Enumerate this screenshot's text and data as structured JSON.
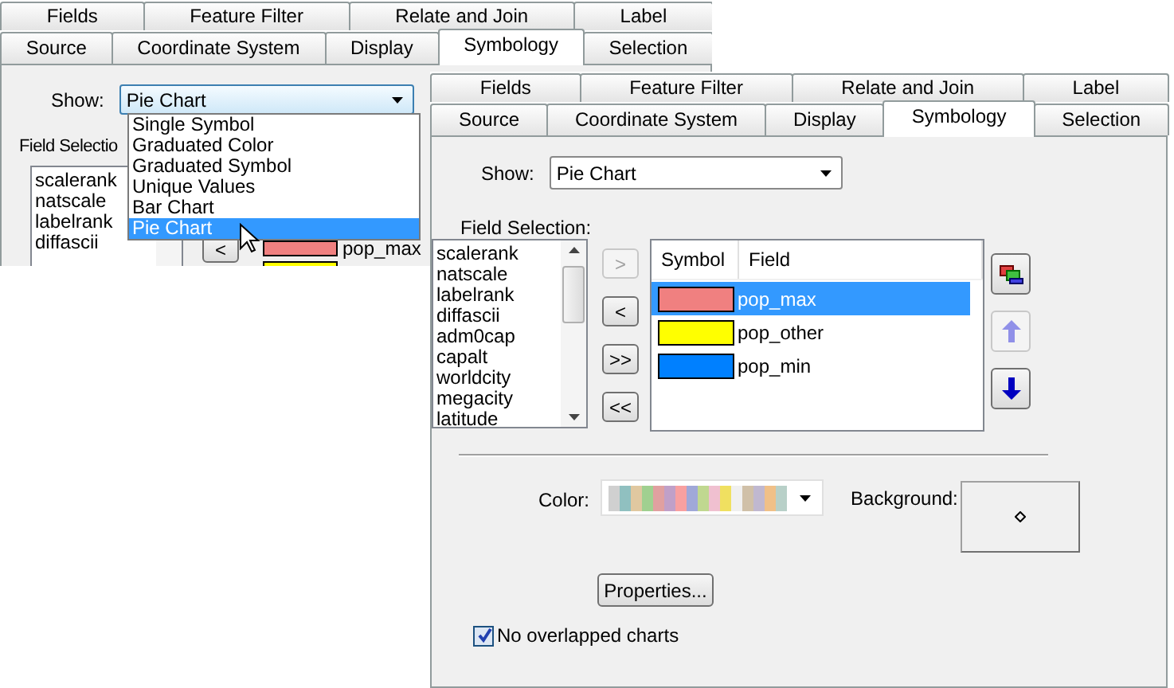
{
  "back_window": {
    "tabs_row_1": [
      {
        "label": "Fields",
        "selected": false
      },
      {
        "label": "Feature Filter",
        "selected": false
      },
      {
        "label": "Relate and Join",
        "selected": false
      },
      {
        "label": "Label",
        "selected": false
      }
    ],
    "tabs_row_2": [
      {
        "label": "Source",
        "selected": false
      },
      {
        "label": "Coordinate System",
        "selected": false
      },
      {
        "label": "Display",
        "selected": false
      },
      {
        "label": "Symbology",
        "selected": true
      },
      {
        "label": "Selection",
        "selected": false
      }
    ],
    "show": {
      "label": "Show:",
      "value": "Pie Chart",
      "expanded": true,
      "options": [
        {
          "label": "Single Symbol",
          "selected": false
        },
        {
          "label": "Graduated Color",
          "selected": false
        },
        {
          "label": "Graduated Symbol",
          "selected": false
        },
        {
          "label": "Unique Values",
          "selected": false
        },
        {
          "label": "Bar Chart",
          "selected": false
        },
        {
          "label": "Pie Chart",
          "selected": true
        }
      ]
    },
    "field_selection_label": "Field Selectio",
    "available_fields": [
      "scalerank",
      "natscale",
      "labelrank",
      "diffascii"
    ],
    "remove_button": "<",
    "selected_fields": [
      {
        "field": "pop_max",
        "color": "#f08080"
      },
      {
        "color": "#ffff00"
      }
    ]
  },
  "front_window": {
    "tabs_row_1": [
      {
        "label": "Fields",
        "selected": false
      },
      {
        "label": "Feature Filter",
        "selected": false
      },
      {
        "label": "Relate and Join",
        "selected": false
      },
      {
        "label": "Label",
        "selected": false
      }
    ],
    "tabs_row_2": [
      {
        "label": "Source",
        "selected": false
      },
      {
        "label": "Coordinate System",
        "selected": false
      },
      {
        "label": "Display",
        "selected": false
      },
      {
        "label": "Symbology",
        "selected": true
      },
      {
        "label": "Selection",
        "selected": false
      }
    ],
    "show": {
      "label": "Show:",
      "value": "Pie Chart",
      "expanded": false
    },
    "field_selection_label": "Field Selection:",
    "available_fields": [
      "scalerank",
      "natscale",
      "labelrank",
      "diffascii",
      "adm0cap",
      "capalt",
      "worldcity",
      "megacity",
      "latitude"
    ],
    "move_buttons": [
      {
        "label": ">",
        "disabled": true
      },
      {
        "label": "<",
        "disabled": false
      },
      {
        "label": ">>",
        "disabled": false
      },
      {
        "label": "<<",
        "disabled": false
      }
    ],
    "table": {
      "columns": [
        "Symbol",
        "Field"
      ],
      "rows": [
        {
          "field": "pop_max",
          "color": "#f08080",
          "selected": true
        },
        {
          "field": "pop_other",
          "color": "#ffff00",
          "selected": false
        },
        {
          "field": "pop_min",
          "color": "#0080ff",
          "selected": false
        }
      ]
    },
    "side_buttons": [
      {
        "kind": "combine",
        "disabled": false
      },
      {
        "kind": "up",
        "disabled": true
      },
      {
        "kind": "down",
        "disabled": false
      }
    ],
    "color_label": "Color:",
    "color_ramp": [
      {
        "color": "#d0d0d0"
      },
      {
        "color": "#90c0c0"
      },
      {
        "color": "#e0c8a0"
      },
      {
        "color": "#a0d090"
      },
      {
        "color": "#e0a0a0"
      },
      {
        "color": "#c0a0c8"
      },
      {
        "color": "#f8a0a0"
      },
      {
        "color": "#a0a8d8"
      },
      {
        "color": "#c0d890"
      },
      {
        "color": "#f0c0d0"
      },
      {
        "color": "#f0e060"
      },
      {
        "color": "#f0f0f0"
      },
      {
        "color": "#d0c0a8"
      },
      {
        "color": "#c0b8d0"
      },
      {
        "color": "#f0c088"
      },
      {
        "color": "#b8d0c8"
      }
    ],
    "background_label": "Background:",
    "properties_button": "Properties...",
    "no_overlap": {
      "label": "No overlapped charts",
      "checked": true
    }
  }
}
